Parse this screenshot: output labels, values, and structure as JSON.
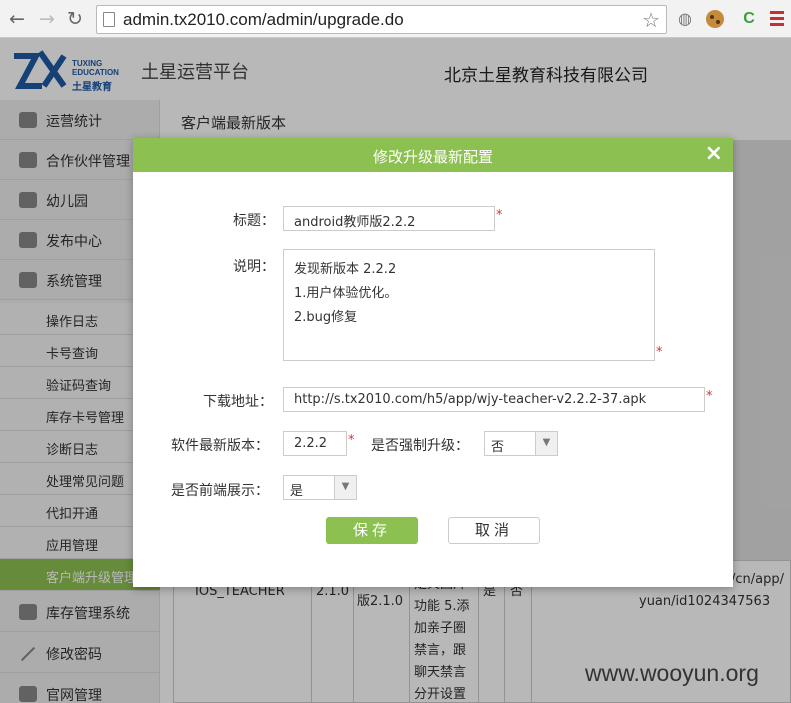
{
  "browser": {
    "url": "admin.tx2010.com/admin/upgrade.do",
    "back_icon": "arrow-left-icon",
    "forward_icon": "arrow-right-icon",
    "reload_icon": "reload-icon",
    "ext_c": "C"
  },
  "header": {
    "logo_en_line1": "TUXING",
    "logo_en_line2": "EDUCATION",
    "logo_cn": "土星教育",
    "platform": "土星运营平台",
    "company": "北京土星教育科技有限公司"
  },
  "sidebar": {
    "items": [
      {
        "label": "运营统计"
      },
      {
        "label": "合作伙伴管理"
      },
      {
        "label": "幼儿园"
      },
      {
        "label": "发布中心"
      },
      {
        "label": "系统管理"
      }
    ],
    "subitems": [
      {
        "label": "操作日志"
      },
      {
        "label": "卡号查询"
      },
      {
        "label": "验证码查询"
      },
      {
        "label": "库存卡号管理"
      },
      {
        "label": "诊断日志"
      },
      {
        "label": "处理常见问题"
      },
      {
        "label": "代扣开通"
      },
      {
        "label": "应用管理"
      },
      {
        "label": "客户端升级管理"
      }
    ],
    "bottom_items": [
      {
        "label": "库存管理系统"
      },
      {
        "label": "修改密码"
      },
      {
        "label": "官网管理"
      }
    ]
  },
  "main": {
    "breadcrumb": "客户端最新版本",
    "table": {
      "cell_platform": "IOS_TEACHER",
      "cell_version": "2.1.0",
      "cell_title": "版2.1.0",
      "cell_desc_lines": [
        "定义图片",
        "功能 5.添",
        "加亲子圈",
        "禁言，跟",
        "聊天禁言",
        "分开设置"
      ],
      "cell_force": "是",
      "cell_show": "否",
      "cell_url_1": "/cn/app/",
      "cell_url_2": "yuan/id1024347563"
    }
  },
  "dialog": {
    "title": "修改升级最新配置",
    "close_label": "×",
    "label_title": "标题：",
    "value_title": "android教师版2.2.2",
    "label_desc": "说明：",
    "desc_lines": [
      "发现新版本 2.2.2",
      "1.用户体验优化。",
      "2.bug修复"
    ],
    "label_url": "下载地址：",
    "value_url": "http://s.tx2010.com/h5/app/wjy-teacher-v2.2.2-37.apk",
    "label_version": "软件最新版本：",
    "value_version": "2.2.2",
    "label_force": "是否强制升级：",
    "value_force": "否",
    "label_show": "是否前端展示：",
    "value_show": "是",
    "required_mark": "*",
    "save_label": "保存",
    "cancel_label": "取消"
  },
  "watermark": "www.wooyun.org"
}
